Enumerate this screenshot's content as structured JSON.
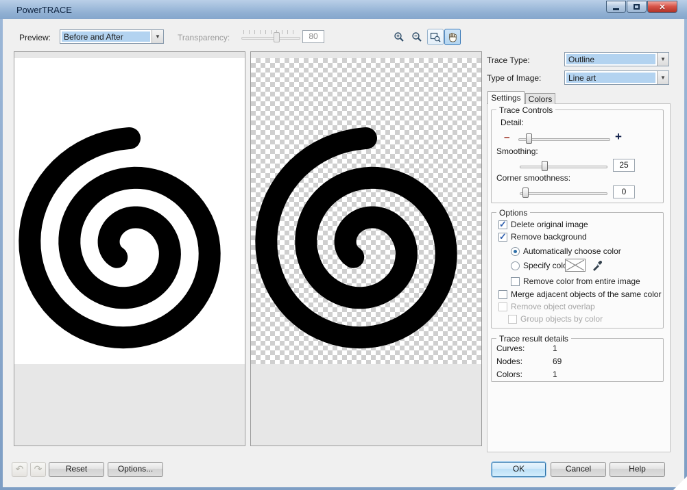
{
  "window": {
    "title": "PowerTRACE"
  },
  "icons": {
    "dropdown_arrow": "▼",
    "close": "✕",
    "undo": "↶",
    "redo": "↷",
    "check": "✓"
  },
  "colors": {
    "selection_blue": "#b3d3f0",
    "titlebar_blue": "#8fafd2",
    "check_blue": "#2f5fae",
    "spiral": "#000000"
  },
  "toolbar": {
    "preview_label": "Preview:",
    "preview_value": "Before and After",
    "transparency_label": "Transparency:",
    "transparency_value": "80"
  },
  "right_panel": {
    "trace_type_label": "Trace Type:",
    "trace_type_value": "Outline",
    "image_type_label": "Type of Image:",
    "image_type_value": "Line art",
    "tabs": [
      {
        "label": "Settings"
      },
      {
        "label": "Colors"
      }
    ],
    "trace_controls": {
      "title": "Trace Controls",
      "detail_label": "Detail:",
      "detail_minus": "−",
      "detail_plus": "+",
      "smoothing_label": "Smoothing:",
      "smoothing_value": "25",
      "corner_label": "Corner smoothness:",
      "corner_value": "0"
    },
    "options": {
      "title": "Options",
      "delete_original": "Delete original image",
      "remove_background": "Remove background",
      "auto_color": "Automatically choose color",
      "specify_color": "Specify color:",
      "remove_entire": "Remove color from entire image",
      "merge_adjacent": "Merge adjacent objects of the same color",
      "remove_overlap": "Remove object overlap",
      "group_by_color": "Group objects by color"
    },
    "results": {
      "title": "Trace result details",
      "rows": [
        {
          "label": "Curves:",
          "value": "1"
        },
        {
          "label": "Nodes:",
          "value": "69"
        },
        {
          "label": "Colors:",
          "value": "1"
        }
      ]
    }
  },
  "footer": {
    "reset": "Reset",
    "options": "Options...",
    "ok": "OK",
    "cancel": "Cancel",
    "help": "Help"
  }
}
